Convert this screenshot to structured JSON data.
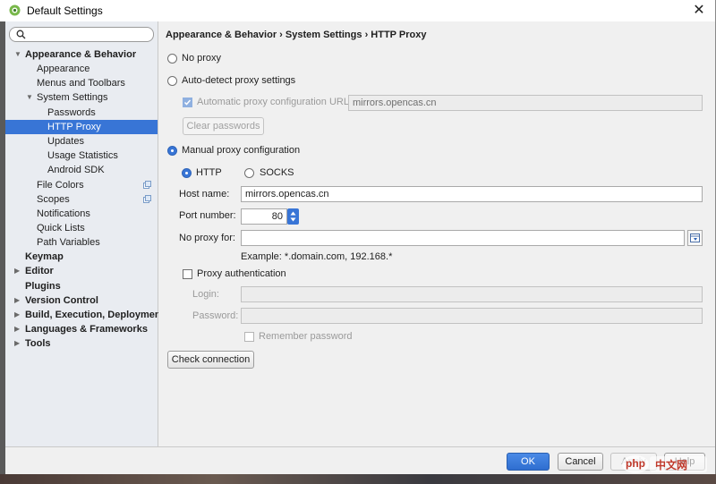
{
  "window": {
    "title": "Default Settings",
    "close_glyph": "✕"
  },
  "search": {
    "placeholder": ""
  },
  "sidebar": {
    "items": [
      {
        "label": "Appearance & Behavior",
        "expanded": true
      },
      {
        "label": "Appearance"
      },
      {
        "label": "Menus and Toolbars"
      },
      {
        "label": "System Settings",
        "expanded": true
      },
      {
        "label": "Passwords"
      },
      {
        "label": "HTTP Proxy",
        "selected": true
      },
      {
        "label": "Updates"
      },
      {
        "label": "Usage Statistics"
      },
      {
        "label": "Android SDK"
      },
      {
        "label": "File Colors"
      },
      {
        "label": "Scopes"
      },
      {
        "label": "Notifications"
      },
      {
        "label": "Quick Lists"
      },
      {
        "label": "Path Variables"
      },
      {
        "label": "Keymap"
      },
      {
        "label": "Editor"
      },
      {
        "label": "Plugins"
      },
      {
        "label": "Version Control"
      },
      {
        "label": "Build, Execution, Deployment"
      },
      {
        "label": "Languages & Frameworks"
      },
      {
        "label": "Tools"
      }
    ]
  },
  "breadcrumb": {
    "part1": "Appearance & Behavior",
    "part2": "System Settings",
    "part3": "HTTP Proxy",
    "sep": "›"
  },
  "proxy": {
    "no_proxy": "No proxy",
    "auto_detect": "Auto-detect proxy settings",
    "auto_config_url_label": "Automatic proxy configuration URL:",
    "auto_config_url_value": "mirrors.opencas.cn",
    "clear_passwords": "Clear passwords",
    "manual": "Manual proxy configuration",
    "http": "HTTP",
    "socks": "SOCKS",
    "host_label": "Host name:",
    "host_value": "mirrors.opencas.cn",
    "port_label": "Port number:",
    "port_value": "80",
    "no_proxy_for_label": "No proxy for:",
    "no_proxy_for_value": "",
    "example": "Example: *.domain.com, 192.168.*",
    "proxy_auth": "Proxy authentication",
    "login_label": "Login:",
    "login_value": "",
    "password_label": "Password:",
    "password_value": "",
    "remember_password": "Remember password",
    "check_connection": "Check connection"
  },
  "footer": {
    "ok": "OK",
    "cancel": "Cancel",
    "apply": "Apply",
    "help": "Help"
  },
  "watermark": {
    "text": "中文网",
    "brand": "php"
  },
  "colors": {
    "accent": "#3875d6",
    "selection": "#3875d6"
  }
}
